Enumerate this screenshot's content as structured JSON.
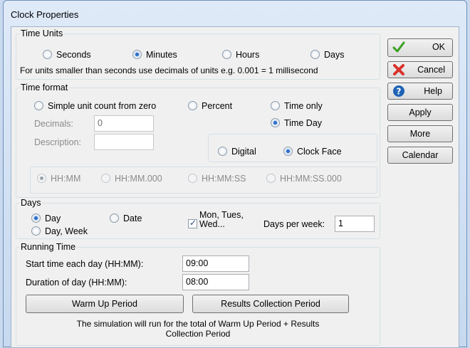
{
  "window": {
    "title": "Clock Properties"
  },
  "time_units": {
    "legend": "Time Units",
    "options": [
      {
        "label": "Seconds",
        "selected": false
      },
      {
        "label": "Minutes",
        "selected": true
      },
      {
        "label": "Hours",
        "selected": false
      },
      {
        "label": "Days",
        "selected": false
      }
    ],
    "note": "For units smaller than seconds use decimals of units e.g. 0.001 = 1 millisecond"
  },
  "time_format": {
    "legend": "Time format",
    "simple_count": {
      "label": "Simple unit count from zero",
      "selected": false
    },
    "percent": {
      "label": "Percent",
      "selected": false
    },
    "time_only": {
      "label": "Time only",
      "selected": false
    },
    "time_day": {
      "label": "Time  Day",
      "selected": true
    },
    "decimals_label": "Decimals:",
    "decimals_value": "0",
    "description_label": "Description:",
    "description_value": "",
    "digital": {
      "label": "Digital",
      "selected": false
    },
    "clock_face": {
      "label": "Clock Face",
      "selected": true
    },
    "formats": [
      {
        "label": "HH:MM",
        "selected": true
      },
      {
        "label": "HH:MM.000",
        "selected": false
      },
      {
        "label": "HH:MM:SS",
        "selected": false
      },
      {
        "label": "HH:MM:SS.000",
        "selected": false
      }
    ]
  },
  "days": {
    "legend": "Days",
    "day": {
      "label": "Day",
      "selected": true
    },
    "date": {
      "label": "Date",
      "selected": false
    },
    "day_week": {
      "label": "Day, Week",
      "selected": false
    },
    "mon_tues_line1": "Mon, Tues,",
    "mon_tues_line2": "Wed...",
    "mon_tues_checked": true,
    "days_per_week_label": "Days per week:",
    "days_per_week_value": "1"
  },
  "running_time": {
    "legend": "Running Time",
    "start_label": "Start time each day (HH:MM):",
    "start_value": "09:00",
    "duration_label": "Duration of day (HH:MM):",
    "duration_value": "08:00",
    "warm_up_button": "Warm Up Period",
    "results_button": "Results Collection Period",
    "note_line1": "The simulation will run for the total of Warm Up Period + Results",
    "note_line2": "Collection Period"
  },
  "buttons": {
    "ok": "OK",
    "cancel": "Cancel",
    "help": "Help",
    "apply": "Apply",
    "more": "More",
    "calendar": "Calendar"
  },
  "colors": {
    "ok_icon": "#3aa01f",
    "cancel_icon": "#d9302a",
    "help_icon": "#1f63b5",
    "radio_selected": "#2a6fcb"
  }
}
